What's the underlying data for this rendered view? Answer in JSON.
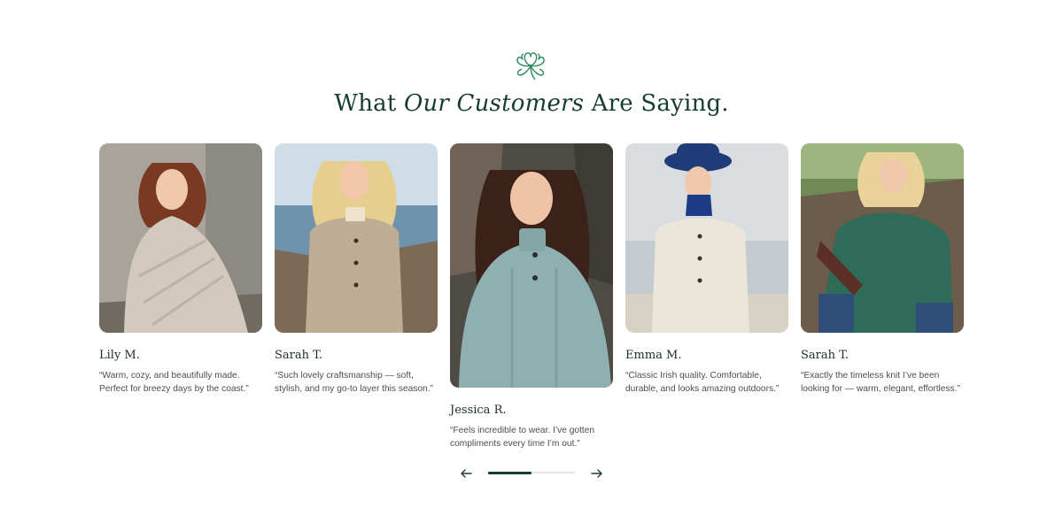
{
  "section": {
    "heading_start": "What ",
    "heading_em": "Our Customers",
    "heading_end": " Are Saying."
  },
  "logo": {
    "icon": "shamrock-icon",
    "color": "#2a8a5a"
  },
  "testimonials": [
    {
      "name": "Lily M.",
      "quote": "“Warm, cozy, and beautifully made. Perfect for breezy days by the coast.”",
      "sweater_color": "#cfc6bc"
    },
    {
      "name": "Sarah T.",
      "quote": "“Such lovely craftsmanship — soft, stylish, and my go-to layer this season.”",
      "sweater_color": "#b9a58c"
    },
    {
      "name": "Jessica R.",
      "quote": "“Feels incredible to wear. I’ve gotten compliments every time I’m out.”",
      "sweater_color": "#8fb0b1"
    },
    {
      "name": "Emma M.",
      "quote": "“Classic Irish quality. Comfortable, durable, and looks amazing outdoors.”",
      "sweater_color": "#ece6d8"
    },
    {
      "name": "Sarah T.",
      "quote": "“Exactly the timeless knit I’ve been looking for — warm, elegant, effortless.”",
      "sweater_color": "#2e6b58"
    }
  ],
  "carousel": {
    "prev_icon": "arrow-left-icon",
    "next_icon": "arrow-right-icon",
    "progress": 0.5
  },
  "colors": {
    "heading": "#163d2e",
    "accent": "#173f30"
  }
}
